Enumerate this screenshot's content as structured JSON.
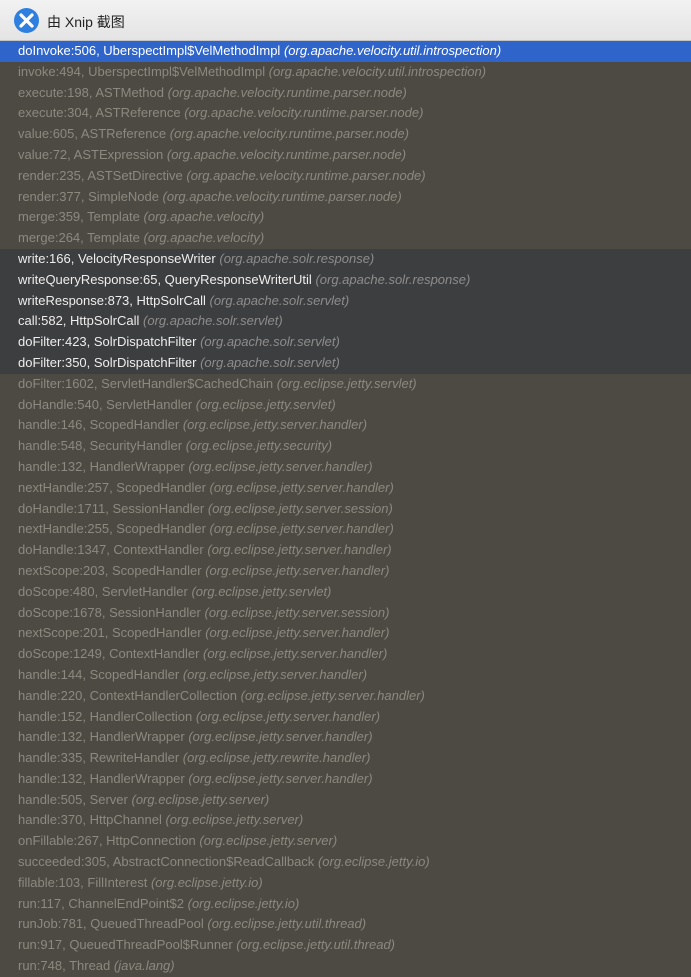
{
  "window": {
    "title": "由 Xnip 截图",
    "icon": "xnip-app-icon"
  },
  "colors": {
    "selected_bg": "#2f65ca",
    "user_frame_bg": "#3d3e40",
    "library_frame_bg": "#4d4a44",
    "library_text": "#8c8980"
  },
  "frames": [
    {
      "method": "doInvoke:506, UberspectImpl$VelMethodImpl",
      "package": "(org.apache.velocity.util.introspection)",
      "state": "selected"
    },
    {
      "method": "invoke:494, UberspectImpl$VelMethodImpl",
      "package": "(org.apache.velocity.util.introspection)",
      "state": "library"
    },
    {
      "method": "execute:198, ASTMethod",
      "package": "(org.apache.velocity.runtime.parser.node)",
      "state": "library"
    },
    {
      "method": "execute:304, ASTReference",
      "package": "(org.apache.velocity.runtime.parser.node)",
      "state": "library"
    },
    {
      "method": "value:605, ASTReference",
      "package": "(org.apache.velocity.runtime.parser.node)",
      "state": "library"
    },
    {
      "method": "value:72, ASTExpression",
      "package": "(org.apache.velocity.runtime.parser.node)",
      "state": "library"
    },
    {
      "method": "render:235, ASTSetDirective",
      "package": "(org.apache.velocity.runtime.parser.node)",
      "state": "library"
    },
    {
      "method": "render:377, SimpleNode",
      "package": "(org.apache.velocity.runtime.parser.node)",
      "state": "library"
    },
    {
      "method": "merge:359, Template",
      "package": "(org.apache.velocity)",
      "state": "library"
    },
    {
      "method": "merge:264, Template",
      "package": "(org.apache.velocity)",
      "state": "library"
    },
    {
      "method": "write:166, VelocityResponseWriter",
      "package": "(org.apache.solr.response)",
      "state": "user"
    },
    {
      "method": "writeQueryResponse:65, QueryResponseWriterUtil",
      "package": "(org.apache.solr.response)",
      "state": "user"
    },
    {
      "method": "writeResponse:873, HttpSolrCall",
      "package": "(org.apache.solr.servlet)",
      "state": "user"
    },
    {
      "method": "call:582, HttpSolrCall",
      "package": "(org.apache.solr.servlet)",
      "state": "user"
    },
    {
      "method": "doFilter:423, SolrDispatchFilter",
      "package": "(org.apache.solr.servlet)",
      "state": "user"
    },
    {
      "method": "doFilter:350, SolrDispatchFilter",
      "package": "(org.apache.solr.servlet)",
      "state": "user"
    },
    {
      "method": "doFilter:1602, ServletHandler$CachedChain",
      "package": "(org.eclipse.jetty.servlet)",
      "state": "library"
    },
    {
      "method": "doHandle:540, ServletHandler",
      "package": "(org.eclipse.jetty.servlet)",
      "state": "library"
    },
    {
      "method": "handle:146, ScopedHandler",
      "package": "(org.eclipse.jetty.server.handler)",
      "state": "library"
    },
    {
      "method": "handle:548, SecurityHandler",
      "package": "(org.eclipse.jetty.security)",
      "state": "library"
    },
    {
      "method": "handle:132, HandlerWrapper",
      "package": "(org.eclipse.jetty.server.handler)",
      "state": "library"
    },
    {
      "method": "nextHandle:257, ScopedHandler",
      "package": "(org.eclipse.jetty.server.handler)",
      "state": "library"
    },
    {
      "method": "doHandle:1711, SessionHandler",
      "package": "(org.eclipse.jetty.server.session)",
      "state": "library"
    },
    {
      "method": "nextHandle:255, ScopedHandler",
      "package": "(org.eclipse.jetty.server.handler)",
      "state": "library"
    },
    {
      "method": "doHandle:1347, ContextHandler",
      "package": "(org.eclipse.jetty.server.handler)",
      "state": "library"
    },
    {
      "method": "nextScope:203, ScopedHandler",
      "package": "(org.eclipse.jetty.server.handler)",
      "state": "library"
    },
    {
      "method": "doScope:480, ServletHandler",
      "package": "(org.eclipse.jetty.servlet)",
      "state": "library"
    },
    {
      "method": "doScope:1678, SessionHandler",
      "package": "(org.eclipse.jetty.server.session)",
      "state": "library"
    },
    {
      "method": "nextScope:201, ScopedHandler",
      "package": "(org.eclipse.jetty.server.handler)",
      "state": "library"
    },
    {
      "method": "doScope:1249, ContextHandler",
      "package": "(org.eclipse.jetty.server.handler)",
      "state": "library"
    },
    {
      "method": "handle:144, ScopedHandler",
      "package": "(org.eclipse.jetty.server.handler)",
      "state": "library"
    },
    {
      "method": "handle:220, ContextHandlerCollection",
      "package": "(org.eclipse.jetty.server.handler)",
      "state": "library"
    },
    {
      "method": "handle:152, HandlerCollection",
      "package": "(org.eclipse.jetty.server.handler)",
      "state": "library"
    },
    {
      "method": "handle:132, HandlerWrapper",
      "package": "(org.eclipse.jetty.server.handler)",
      "state": "library"
    },
    {
      "method": "handle:335, RewriteHandler",
      "package": "(org.eclipse.jetty.rewrite.handler)",
      "state": "library"
    },
    {
      "method": "handle:132, HandlerWrapper",
      "package": "(org.eclipse.jetty.server.handler)",
      "state": "library"
    },
    {
      "method": "handle:505, Server",
      "package": "(org.eclipse.jetty.server)",
      "state": "library"
    },
    {
      "method": "handle:370, HttpChannel",
      "package": "(org.eclipse.jetty.server)",
      "state": "library"
    },
    {
      "method": "onFillable:267, HttpConnection",
      "package": "(org.eclipse.jetty.server)",
      "state": "library"
    },
    {
      "method": "succeeded:305, AbstractConnection$ReadCallback",
      "package": "(org.eclipse.jetty.io)",
      "state": "library"
    },
    {
      "method": "fillable:103, FillInterest",
      "package": "(org.eclipse.jetty.io)",
      "state": "library"
    },
    {
      "method": "run:117, ChannelEndPoint$2",
      "package": "(org.eclipse.jetty.io)",
      "state": "library"
    },
    {
      "method": "runJob:781, QueuedThreadPool",
      "package": "(org.eclipse.jetty.util.thread)",
      "state": "library"
    },
    {
      "method": "run:917, QueuedThreadPool$Runner",
      "package": "(org.eclipse.jetty.util.thread)",
      "state": "library"
    },
    {
      "method": "run:748, Thread",
      "package": "(java.lang)",
      "state": "library"
    }
  ]
}
